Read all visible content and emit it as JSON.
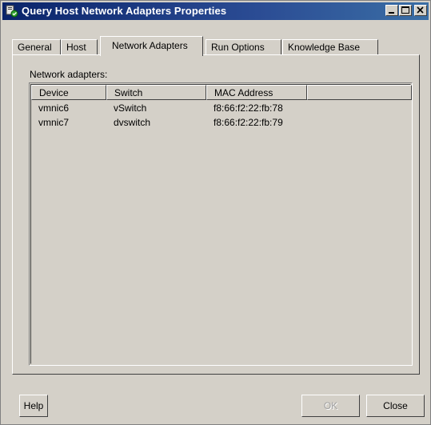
{
  "window": {
    "title": "Query Host Network Adapters Properties"
  },
  "tabs": [
    "General",
    "Host",
    "Network Adapters",
    "Run Options",
    "Knowledge Base"
  ],
  "active_tab": "Network Adapters",
  "group_label": "Network adapters:",
  "table": {
    "columns": [
      "Device",
      "Switch",
      "MAC Address",
      ""
    ],
    "rows": [
      [
        "vmnic6",
        "vSwitch",
        "f8:66:f2:22:fb:78"
      ],
      [
        "vmnic7",
        "dvswitch",
        "f8:66:f2:22:fb:79"
      ]
    ]
  },
  "buttons": {
    "help": "Help",
    "ok": "OK",
    "close": "Close"
  },
  "colors": {
    "titlebar_start": "#0a246a",
    "titlebar_end": "#3a6ea5",
    "face": "#d4d0c8"
  }
}
